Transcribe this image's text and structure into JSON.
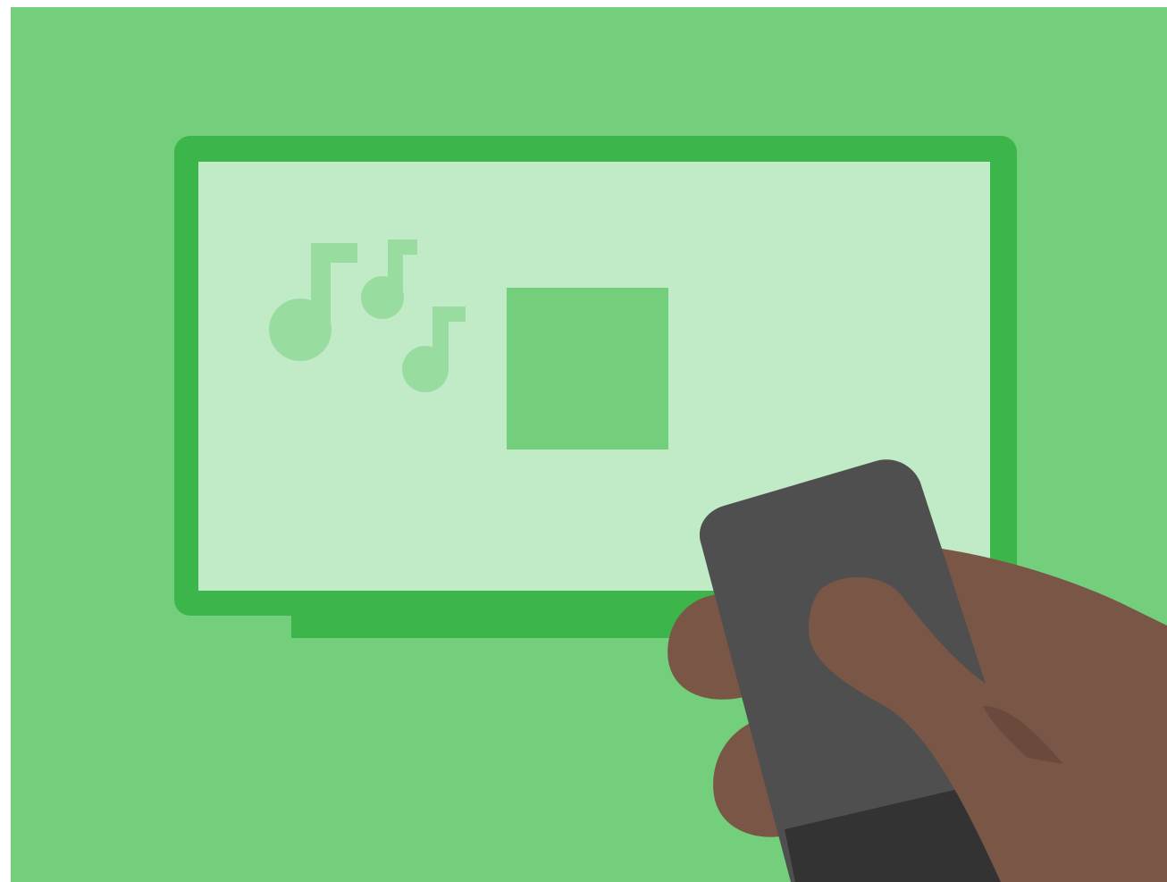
{
  "illustration": {
    "subject": "hand-holding-remote-pointing-at-tv",
    "icons": [
      "music-note-icon",
      "music-note-icon",
      "music-note-icon",
      "media-placeholder-icon",
      "tv-icon",
      "remote-control-icon",
      "hand-icon"
    ],
    "colors": {
      "background": "#73cf7b",
      "tv_frame": "#3cb54a",
      "tv_screen": "#c1eac6",
      "music_note": "#99dca0",
      "content_square": "#73cf7b",
      "remote_body": "#4f4f4f",
      "remote_bottom": "#333333",
      "skin": "#7a5646",
      "skin_shadow": "#6b4a3d"
    }
  }
}
